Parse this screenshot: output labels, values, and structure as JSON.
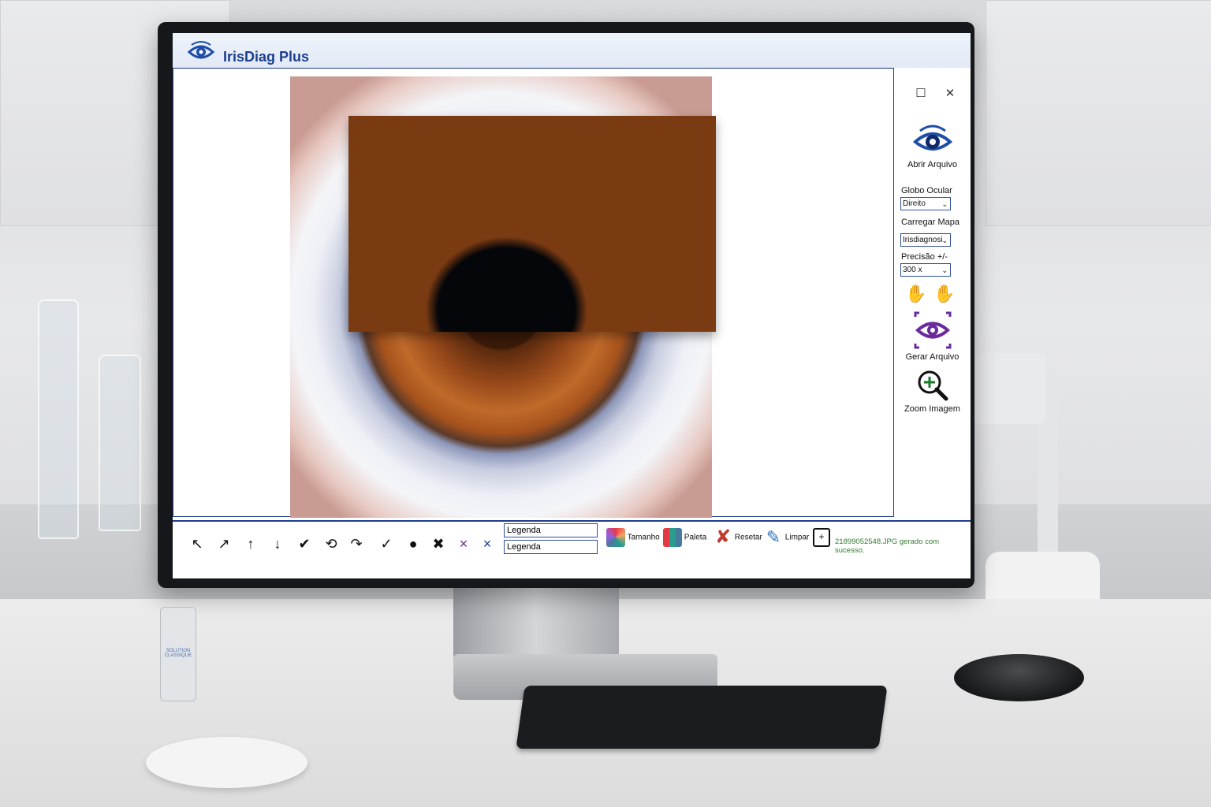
{
  "app": {
    "title": "IrisDiag Plus"
  },
  "window_controls": {
    "minimize": "–",
    "maximize": "☐",
    "close": "✕"
  },
  "right_panel": {
    "open_file_label": "Abrir Arquivo",
    "globe_label": "Globo Ocular",
    "globe_value": "Direito",
    "map_label": "Carregar Mapa",
    "map_value": "Irisdiagnosi",
    "precision_label": "Precisão +/-",
    "precision_value": "300 x",
    "generate_label": "Gerar Arquivo",
    "zoom_label": "Zoom Imagem"
  },
  "toolbar": {
    "tools": [
      "↖",
      "↗",
      "↑",
      "↓",
      "✔",
      "⟲",
      "↷",
      "✓",
      "●",
      "✖",
      "×",
      "×"
    ],
    "legend_1": "Legenda",
    "legend_2": "Legenda",
    "size_label": "Tamanho",
    "palette_label": "Paleta",
    "reset_label": "Resetar",
    "clear_label": "Limpar",
    "status_text": "21899052548.JPG gerado com sucesso."
  },
  "desk": {
    "bottle_label": "SOLUTION CLASSIQUE"
  },
  "colors": {
    "accent": "#1e3b8f",
    "title": "#1b3f8f",
    "status_green": "#2f7d2f",
    "eye_purple": "#6a2a9c"
  }
}
